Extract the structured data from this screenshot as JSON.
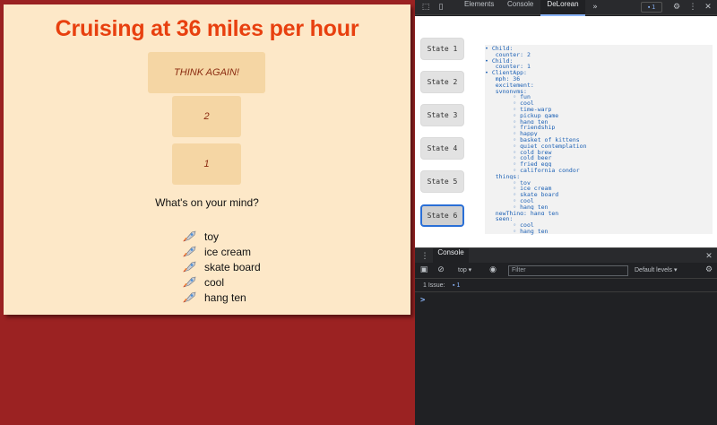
{
  "app": {
    "heading": "Cruising at 36 miles per hour",
    "think_button": "THINK AGAIN!",
    "counters": [
      "2",
      "1"
    ],
    "prompt": "What's on your mind?",
    "things": [
      "toy",
      "ice cream",
      "skate board",
      "cool",
      "hang ten"
    ]
  },
  "devtools": {
    "tabs": [
      "Elements",
      "Console",
      "DeLorean"
    ],
    "active_tab": "DeLorean",
    "issues_count": "1",
    "states": [
      "State 1",
      "State 2",
      "State 3",
      "State 4",
      "State 5",
      "State 6"
    ],
    "active_state": "State 6",
    "state_tree": [
      "• Child:",
      "   counter: 2",
      "• Child:",
      "   counter: 1",
      "• ClientApp:",
      "   mph: 36",
      "   excitement:",
      "   synonyms:",
      "        ◦ fun",
      "        ◦ cool",
      "        ◦ time-warp",
      "        ◦ pickup game",
      "        ◦ hang ten",
      "        ◦ friendship",
      "        ◦ happy",
      "        ◦ basket of kittens",
      "        ◦ quiet contemplation",
      "        ◦ cold brew",
      "        ◦ cold beer",
      "        ◦ fried egg",
      "        ◦ california condor",
      "   things:",
      "        ◦ toy",
      "        ◦ ice cream",
      "        ◦ skate board",
      "        ◦ cool",
      "        ◦ hang ten",
      "   newThing: hang ten",
      "   seen:",
      "        ◦ cool",
      "        ◦ hang ten"
    ],
    "drawer": {
      "tab": "Console",
      "context": "top",
      "filter_placeholder": "Filter",
      "levels": "Default levels",
      "issues_label": "1 Issue:",
      "issues_count": "1",
      "prompt": ">"
    }
  }
}
